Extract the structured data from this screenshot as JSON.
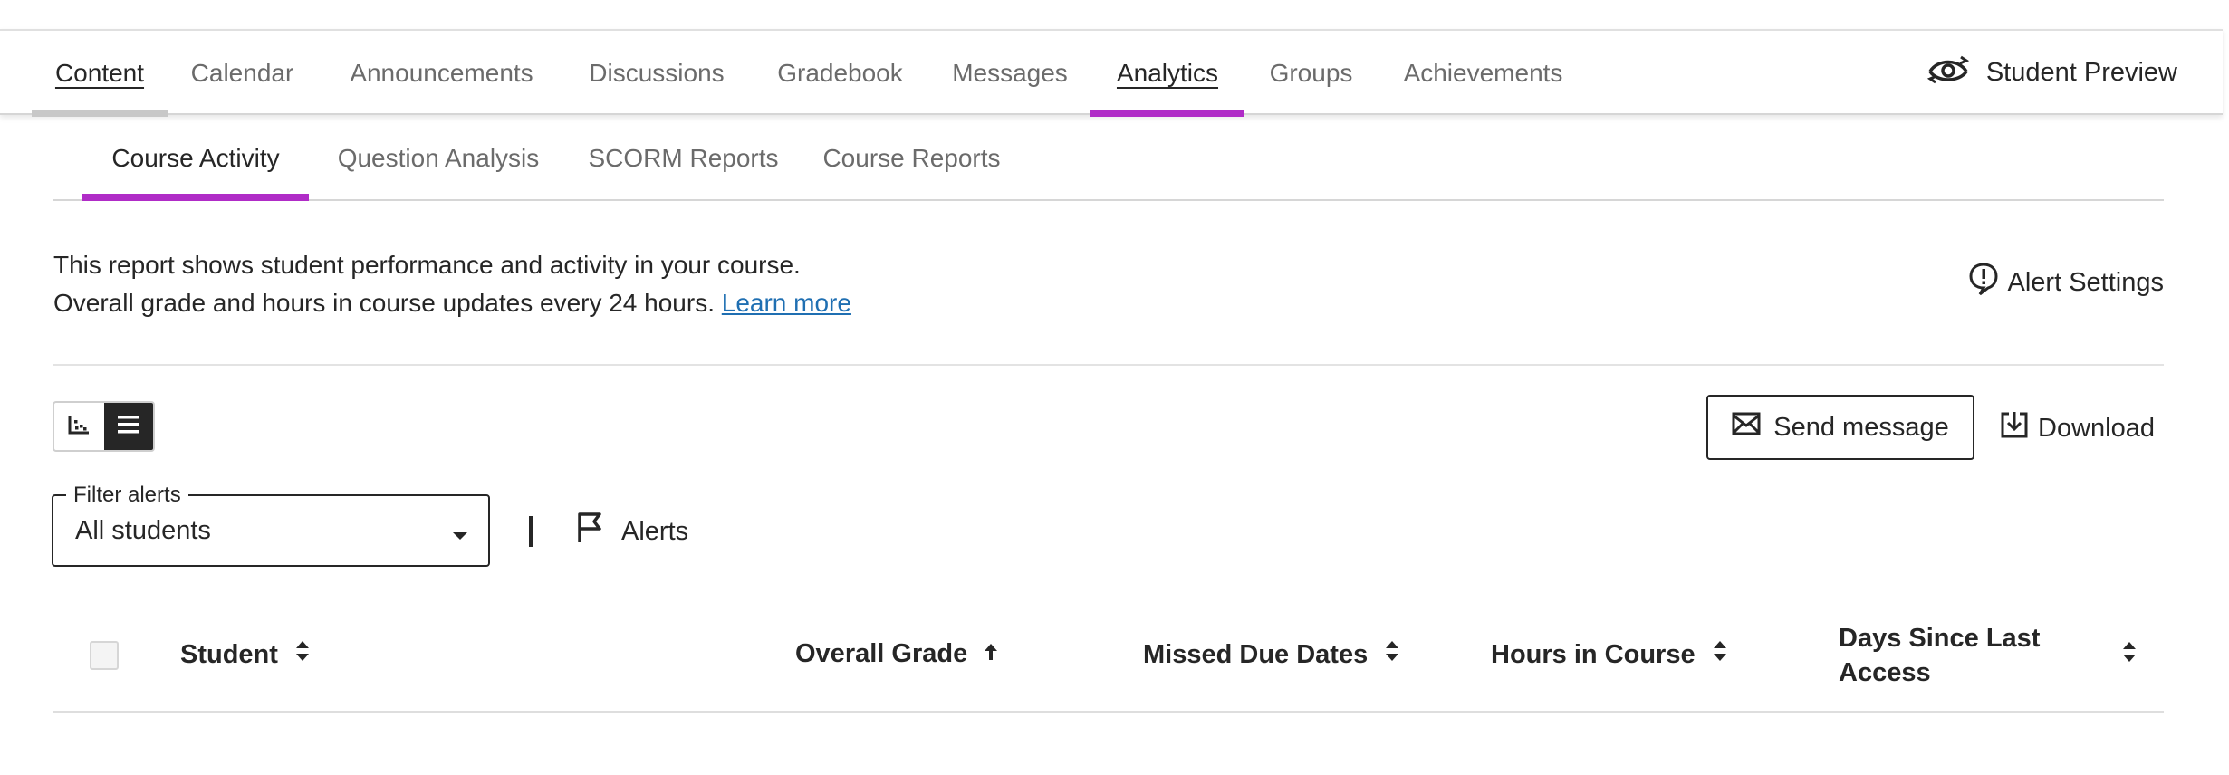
{
  "nav": {
    "tabs": [
      {
        "label": "Content"
      },
      {
        "label": "Calendar"
      },
      {
        "label": "Announcements"
      },
      {
        "label": "Discussions"
      },
      {
        "label": "Gradebook"
      },
      {
        "label": "Messages"
      },
      {
        "label": "Analytics"
      },
      {
        "label": "Groups"
      },
      {
        "label": "Achievements"
      }
    ],
    "student_preview": "Student Preview"
  },
  "subnav": {
    "tabs": [
      {
        "label": "Course Activity"
      },
      {
        "label": "Question Analysis"
      },
      {
        "label": "SCORM Reports"
      },
      {
        "label": "Course Reports"
      }
    ]
  },
  "description": {
    "line1": "This report shows student performance and activity in your course.",
    "line2": "Overall grade and hours in course updates every 24 hours.",
    "learn_more": "Learn more"
  },
  "alert_settings": "Alert Settings",
  "actions": {
    "send_message": "Send message",
    "download": "Download"
  },
  "filter": {
    "legend": "Filter alerts",
    "value": "All students"
  },
  "alerts_label": "Alerts",
  "table": {
    "columns": [
      {
        "label": "Student"
      },
      {
        "label": "Overall Grade"
      },
      {
        "label": "Missed Due Dates"
      },
      {
        "label": "Hours in Course"
      },
      {
        "label": "Days Since Last Access"
      }
    ]
  },
  "colors": {
    "accent": "#b02cc7",
    "link": "#1f6fb2",
    "text": "#262626",
    "muted": "#6b6b6b"
  }
}
